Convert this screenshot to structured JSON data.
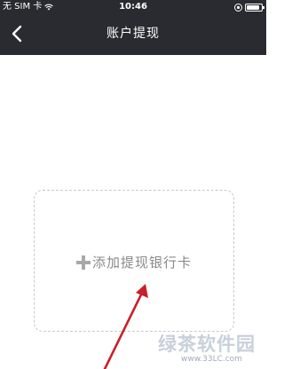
{
  "status_bar": {
    "carrier": "无 SIM 卡",
    "time": "10:46",
    "wifi_icon": "wifi-icon",
    "rotation_lock_icon": "rotation-lock-icon",
    "battery_icon": "battery-icon"
  },
  "nav": {
    "title": "账户提现",
    "back_icon": "chevron-left-icon"
  },
  "add_card": {
    "icon": "plus-icon",
    "label": "添加提现银行卡"
  },
  "watermark": {
    "text": "绿茶软件园",
    "sub": "www.33LC.com"
  },
  "colors": {
    "header_bg": "#2a2b30",
    "header_text": "#ffffff",
    "card_border": "#c9c9c9",
    "card_text": "#8a8a8a",
    "arrow": "#c8202a"
  }
}
